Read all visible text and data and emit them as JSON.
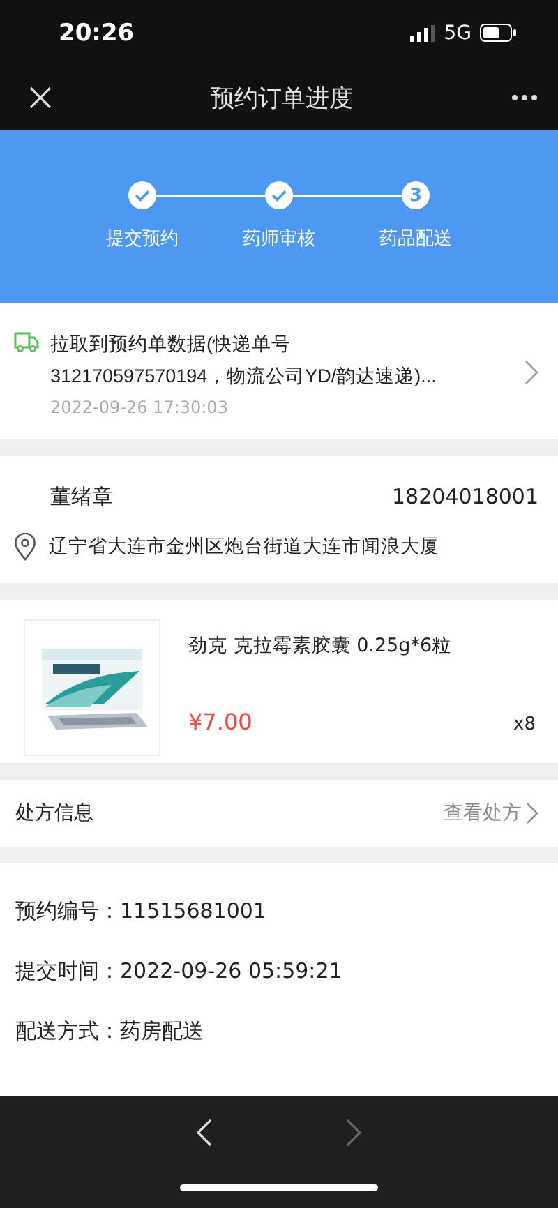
{
  "status_bar": {
    "time": "20:26",
    "network": "5G"
  },
  "nav": {
    "title": "预约订单进度"
  },
  "steps": [
    {
      "label": "提交预约",
      "done": true
    },
    {
      "label": "药师审核",
      "done": true
    },
    {
      "label": "药品配送",
      "done": false,
      "number": "3"
    }
  ],
  "logistics": {
    "text": "拉取到预约单数据(快递单号312170597570194，物流公司YD/韵达速递)...",
    "time": "2022-09-26 17:30:03"
  },
  "address": {
    "name": "董绪章",
    "phone": "18204018001",
    "address": "辽宁省大连市金州区炮台街道大连市闻浪大厦"
  },
  "product": {
    "name": "劲克 克拉霉素胶囊 0.25g*6粒",
    "price": "¥7.00",
    "quantity": "x8"
  },
  "prescription": {
    "label": "处方信息",
    "link": "查看处方"
  },
  "info": [
    {
      "label": "预约编号：",
      "value": "11515681001"
    },
    {
      "label": "提交时间：",
      "value": "2022-09-26 05:59:21"
    },
    {
      "label": "配送方式：",
      "value": "药房配送"
    }
  ]
}
